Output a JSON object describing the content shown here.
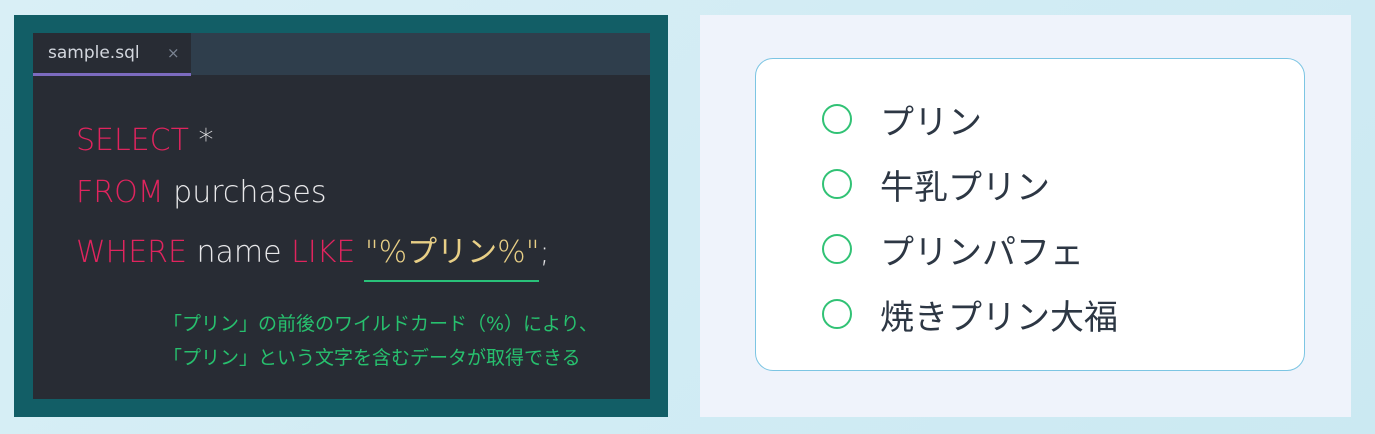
{
  "editor": {
    "tab_label": "sample.sql",
    "tab_close": "×",
    "code": {
      "line1": {
        "keyword": "SELECT",
        "rest": " *"
      },
      "line2": {
        "keyword": "FROM",
        "rest": " purchases"
      },
      "line3": {
        "keyword1": "WHERE",
        "middle": " name ",
        "keyword2": "LIKE",
        "string": " \"%プリン%\"",
        "end": ";"
      }
    },
    "note": {
      "line1": "「プリン」の前後のワイルドカード（%）により、",
      "line2": "「プリン」という文字を含むデータが取得できる"
    }
  },
  "choices": {
    "options": [
      {
        "label": "プリン"
      },
      {
        "label": "牛乳プリン"
      },
      {
        "label": "プリンパフェ"
      },
      {
        "label": "焼きプリン大福"
      }
    ]
  },
  "colors": {
    "keyword": "#e0245e",
    "string": "#e8cf86",
    "note": "#27c06e",
    "radio": "#31c275",
    "card_border": "#7cc5e3",
    "frame": "#125e66"
  }
}
